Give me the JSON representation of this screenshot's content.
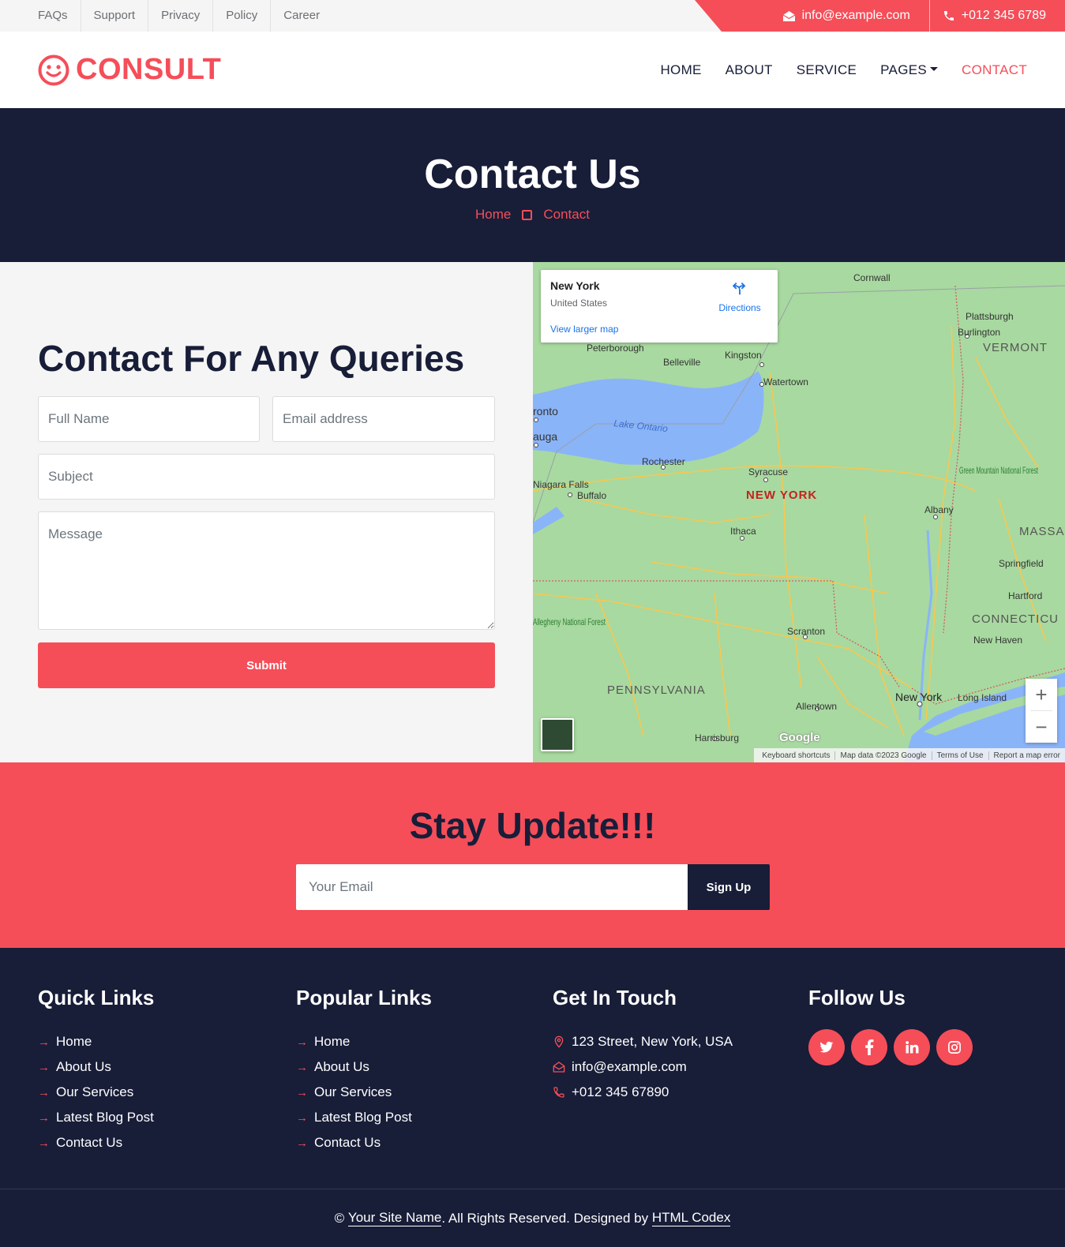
{
  "topbar": {
    "links": [
      "FAQs",
      "Support",
      "Privacy",
      "Policy",
      "Career"
    ],
    "email": "info@example.com",
    "phone": "+012 345 6789"
  },
  "brand": {
    "name": "CONSULT",
    "icon": "smile-icon",
    "color": "#f54e59"
  },
  "nav": {
    "items": [
      "HOME",
      "ABOUT",
      "SERVICE",
      "PAGES",
      "CONTACT"
    ],
    "active": "CONTACT"
  },
  "hero": {
    "title": "Contact Us",
    "breadcrumb": [
      "Home",
      "Contact"
    ]
  },
  "contact": {
    "heading": "Contact For Any Queries",
    "name_placeholder": "Full Name",
    "email_placeholder": "Email address",
    "subject_placeholder": "Subject",
    "message_placeholder": "Message",
    "submit_label": "Submit"
  },
  "map": {
    "place": "New York",
    "country": "United States",
    "directions": "Directions",
    "larger_map": "View larger map",
    "state_label": "NEW YORK",
    "labels": {
      "pennsylvania": "PENNSYLVANIA",
      "vermont": "VERMONT",
      "connecticut": "CONNECTICU",
      "massachusetts": "MASSA",
      "lake": "Lake Ontario",
      "cornwall": "Cornwall",
      "plattsburgh": "Plattsburgh",
      "burlington": "Burlington",
      "peterborough": "Peterborough",
      "belleville": "Belleville",
      "kingston": "Kingston",
      "watertown": "Watertown",
      "toronto": "ronto",
      "mississauga": "auga",
      "rochester": "Rochester",
      "syracuse": "Syracuse",
      "niagara": "Niagara Falls",
      "buffalo": "Buffalo",
      "albany": "Albany",
      "green_mountain": "Green Mountain National Forest",
      "ithaca": "Ithaca",
      "springfield": "Springfield",
      "hartford": "Hartford",
      "allegheny": "Allegheny National Forest",
      "scranton": "Scranton",
      "new_haven": "New Haven",
      "new_york_city": "New York",
      "long_island": "Long Island",
      "allentown": "Allentown",
      "harrisburg": "Harrisburg"
    },
    "google": "Google",
    "attribution": [
      "Keyboard shortcuts",
      "Map data ©2023 Google",
      "Terms of Use",
      "Report a map error"
    ],
    "zoom_in": "+",
    "zoom_out": "−",
    "colors": {
      "land": "#a8d9a0",
      "water": "#8ab4f8",
      "road": "#f9c74f"
    }
  },
  "newsletter": {
    "heading": "Stay Update!!!",
    "placeholder": "Your Email",
    "button": "Sign Up"
  },
  "footer": {
    "quick_links": {
      "title": "Quick Links",
      "items": [
        "Home",
        "About Us",
        "Our Services",
        "Latest Blog Post",
        "Contact Us"
      ]
    },
    "popular_links": {
      "title": "Popular Links",
      "items": [
        "Home",
        "About Us",
        "Our Services",
        "Latest Blog Post",
        "Contact Us"
      ]
    },
    "get_in_touch": {
      "title": "Get In Touch",
      "address": "123 Street, New York, USA",
      "email": "info@example.com",
      "phone": "+012 345 67890"
    },
    "follow_us": {
      "title": "Follow Us",
      "icons": [
        "twitter-icon",
        "facebook-icon",
        "linkedin-icon",
        "instagram-icon"
      ]
    },
    "copyright": {
      "prefix": "© ",
      "site": "Your Site Name",
      "middle": ". All Rights Reserved. Designed by ",
      "designer": "HTML Codex"
    }
  },
  "colors": {
    "accent": "#f54e59",
    "dark": "#181d38",
    "light_bg": "#f5f5f5"
  }
}
